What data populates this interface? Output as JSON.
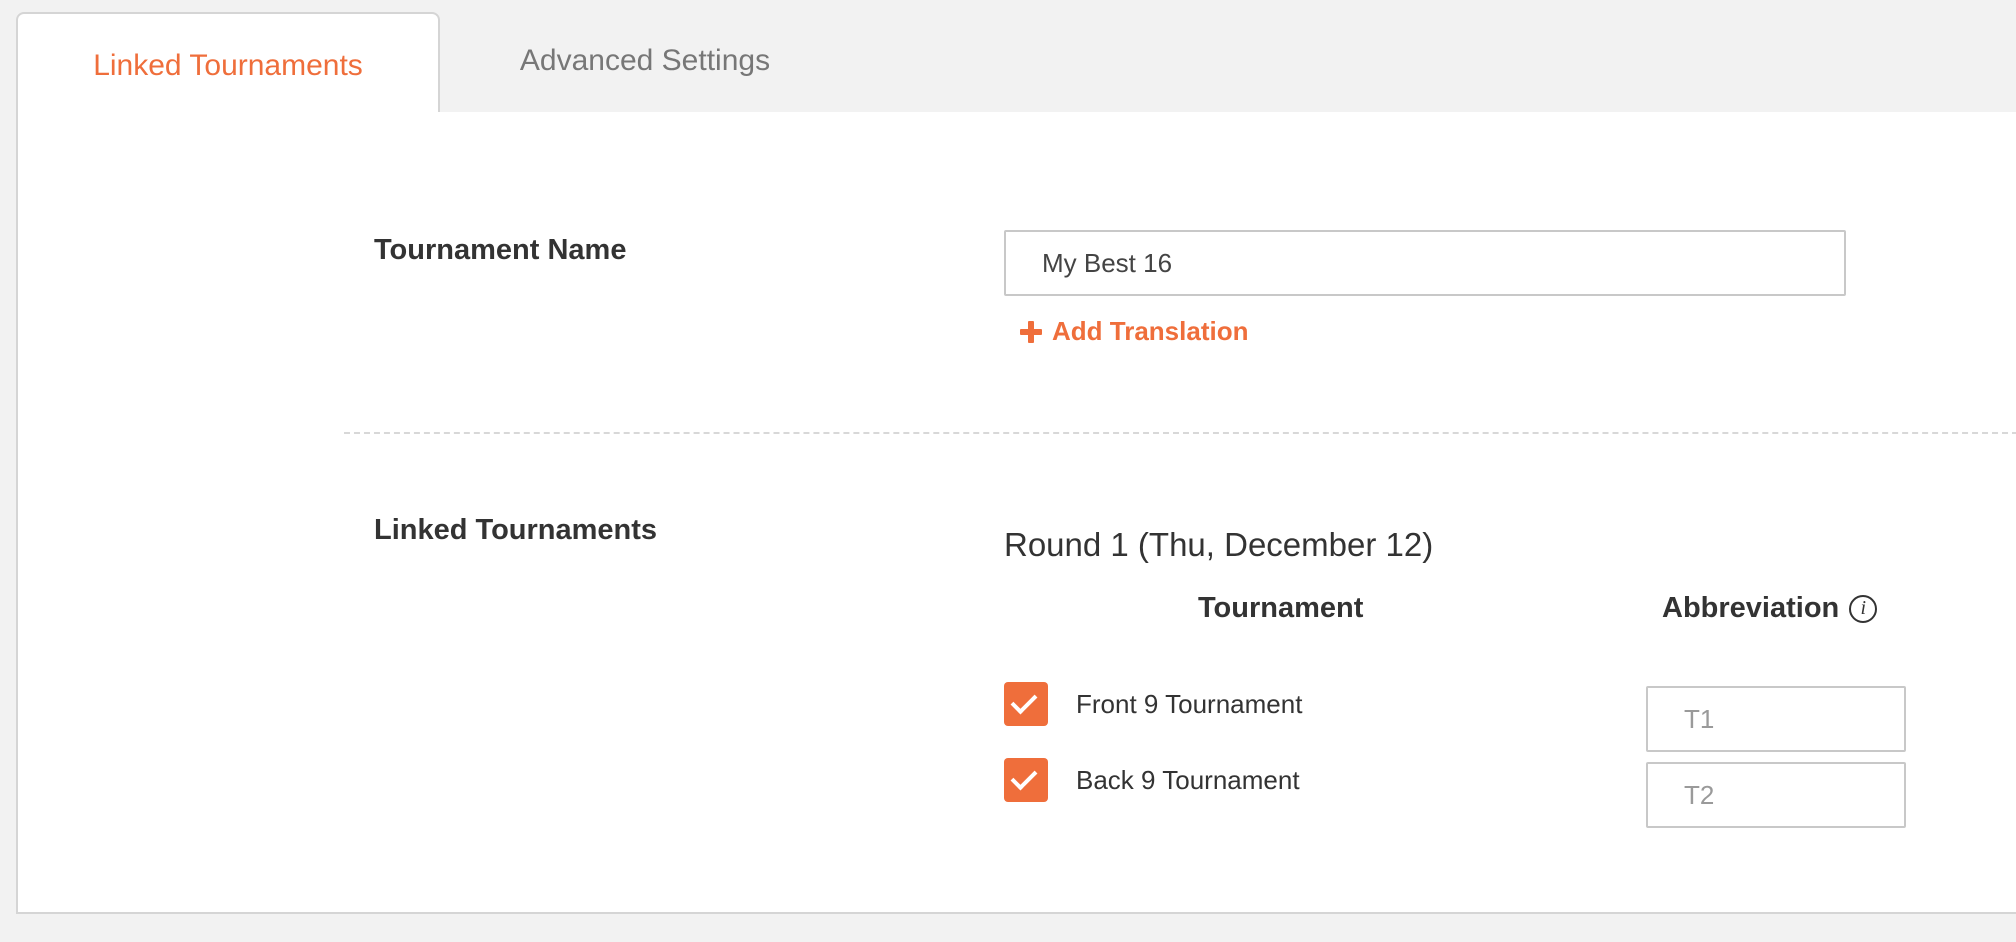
{
  "tabs": [
    {
      "label": "Linked Tournaments",
      "active": true
    },
    {
      "label": "Advanced Settings",
      "active": false
    }
  ],
  "form": {
    "tournament_name_label": "Tournament Name",
    "tournament_name_value": "My Best 16",
    "add_translation_label": "Add Translation",
    "linked_label": "Linked Tournaments"
  },
  "round": {
    "title": "Round 1 (Thu, December 12)",
    "col_tournament": "Tournament",
    "col_abbreviation": "Abbreviation",
    "items": [
      {
        "name": "Front 9 Tournament",
        "checked": true,
        "abbreviation_placeholder": "T1"
      },
      {
        "name": "Back 9 Tournament",
        "checked": true,
        "abbreviation_placeholder": "T2"
      }
    ]
  },
  "colors": {
    "accent": "#ef6e3b",
    "text": "#333333",
    "tab_inactive": "#777777",
    "background": "#f2f2f2"
  },
  "icons": {
    "add": "plus-icon",
    "info": "info-icon",
    "check": "checkmark-icon"
  }
}
